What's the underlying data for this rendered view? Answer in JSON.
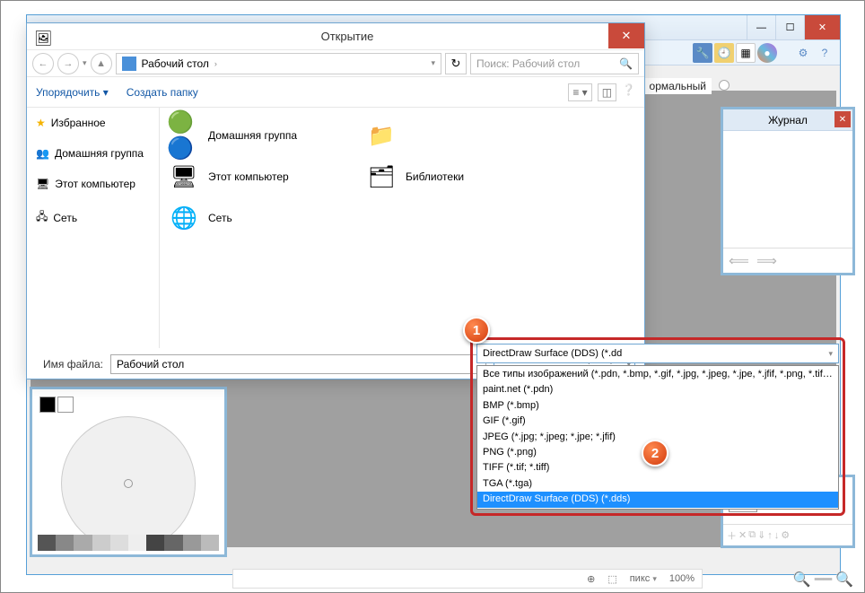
{
  "app": {
    "titlebar": {
      "min": "—",
      "max": "☐",
      "close": "✕"
    },
    "word_normal": "ормальный",
    "history_panel_title": "Журнал",
    "history_close": "✕",
    "statusbar": {
      "unit": "пикс",
      "arrow": "▾",
      "zoom": "100%"
    }
  },
  "dialog": {
    "title": "Открытие",
    "close": "✕",
    "nav": {
      "back": "←",
      "fwd": "→",
      "up": "▲",
      "location": "Рабочий стол",
      "chev": "›",
      "dropdown": "▾",
      "reload": "↻"
    },
    "search": {
      "placeholder": "Поиск: Рабочий стол",
      "icon": "🔍"
    },
    "toolbar": {
      "organize": "Упорядочить ▾",
      "newfolder": "Создать папку"
    },
    "sidebar": {
      "favorites": "Избранное",
      "homegroup": "Домашняя группа",
      "computer": "Этот компьютер",
      "network": "Сеть"
    },
    "content": {
      "homegroup": "Домашняя группа",
      "computer": "Этот компьютер",
      "network": "Сеть",
      "libraries": "Библиотеки"
    },
    "footer": {
      "label": "Имя файла:",
      "value": "Рабочий стол",
      "filetype_selected": "DirectDraw Surface (DDS) (*.dd"
    }
  },
  "dropdown": {
    "options": [
      "Все типы изображений (*.pdn, *.bmp, *.gif, *.jpg, *.jpeg, *.jpe, *.jfif, *.png, *.tif, *.tiff, *",
      "paint.net (*.pdn)",
      "BMP (*.bmp)",
      "GIF (*.gif)",
      "JPEG (*.jpg; *.jpeg; *.jpe; *.jfif)",
      "PNG (*.png)",
      "TIFF (*.tif; *.tiff)",
      "TGA (*.tga)",
      "DirectDraw Surface (DDS) (*.dds)"
    ],
    "selected_index": 8
  },
  "badges": {
    "one": "1",
    "two": "2"
  }
}
